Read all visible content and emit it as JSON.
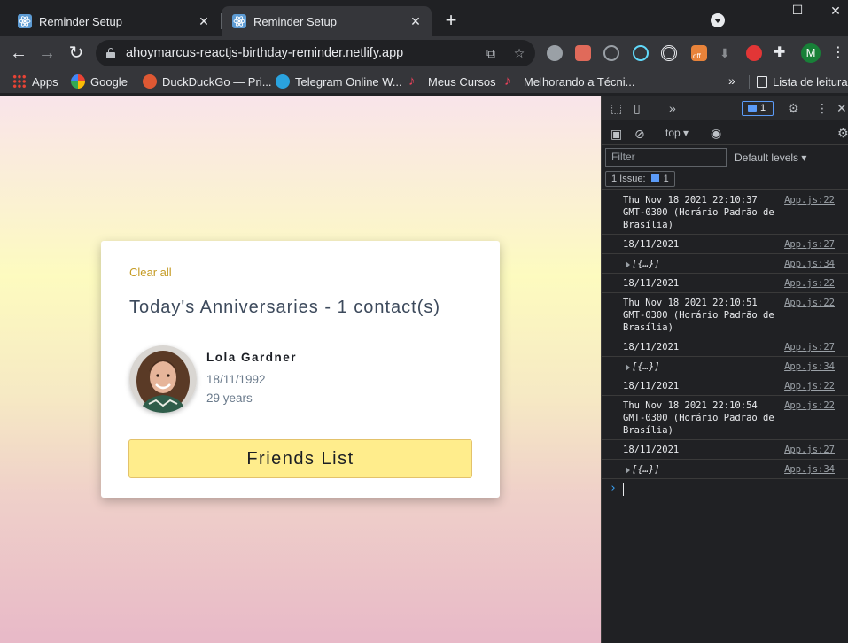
{
  "browser": {
    "tabs": [
      {
        "title": "Reminder Setup",
        "active": false
      },
      {
        "title": "Reminder Setup",
        "active": true
      }
    ],
    "url": "ahoymarcus-reactjs-birthday-reminder.netlify.app",
    "profile_initial": "M",
    "extension_badge": "off",
    "bookmarks": [
      {
        "label": "Apps",
        "icon": "apps-grid-icon"
      },
      {
        "label": "Google",
        "icon": "google-icon"
      },
      {
        "label": "DuckDuckGo — Pri...",
        "icon": "duckduckgo-icon"
      },
      {
        "label": "Telegram Online W...",
        "icon": "telegram-icon"
      },
      {
        "label": "Meus Cursos",
        "icon": "music-note-icon"
      },
      {
        "label": "Melhorando a Técni...",
        "icon": "music-note-icon"
      },
      {
        "label": "Lista de leitura",
        "icon": "reading-list-icon"
      }
    ]
  },
  "app": {
    "clear_all": "Clear all",
    "title": "Today's Anniversaries - 1 contact(s)",
    "contact": {
      "name": "Lola Gardner",
      "date": "18/11/1992",
      "age": "29 years"
    },
    "friends_button": "Friends List"
  },
  "devtools": {
    "issues_badge": "1",
    "context": "top",
    "filter_placeholder": "Filter",
    "levels": "Default levels",
    "issue_label": "1 Issue:",
    "issue_count": "1",
    "logs": [
      {
        "msg": "Thu Nov 18 2021 22:10:37\nGMT-0300 (Horário Padrão de\nBrasília)",
        "src": "App.js:22",
        "obj": false
      },
      {
        "msg": "18/11/2021",
        "src": "App.js:27",
        "obj": false
      },
      {
        "msg": "[{…}]",
        "src": "App.js:34",
        "obj": true
      },
      {
        "msg": "18/11/2021",
        "src": "App.js:22",
        "obj": false
      },
      {
        "msg": "Thu Nov 18 2021 22:10:51\nGMT-0300 (Horário Padrão de\nBrasília)",
        "src": "App.js:22",
        "obj": false
      },
      {
        "msg": "18/11/2021",
        "src": "App.js:27",
        "obj": false
      },
      {
        "msg": "[{…}]",
        "src": "App.js:34",
        "obj": true
      },
      {
        "msg": "18/11/2021",
        "src": "App.js:22",
        "obj": false
      },
      {
        "msg": "Thu Nov 18 2021 22:10:54\nGMT-0300 (Horário Padrão de\nBrasília)",
        "src": "App.js:22",
        "obj": false
      },
      {
        "msg": "18/11/2021",
        "src": "App.js:27",
        "obj": false
      },
      {
        "msg": "[{…}]",
        "src": "App.js:34",
        "obj": true
      }
    ],
    "prompt": "›"
  },
  "colors": {
    "accent": "#c59b24",
    "button_bg": "#ffed8c",
    "chrome_dark": "#202124"
  }
}
